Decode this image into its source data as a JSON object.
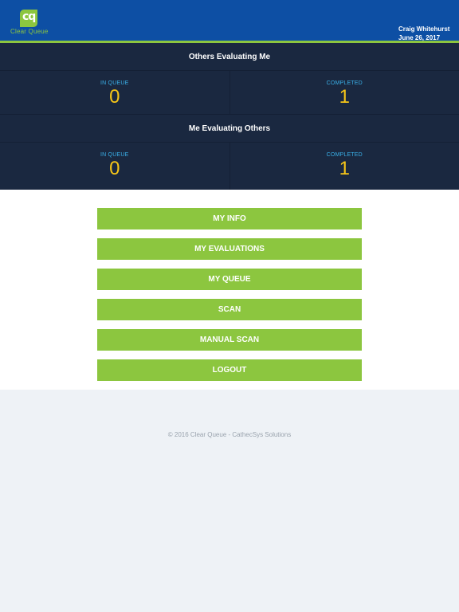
{
  "header": {
    "logo_text": "Clear Queue",
    "logo_mark": "cq",
    "user_name": "Craig Whitehurst",
    "date": "June 26, 2017"
  },
  "stats": {
    "others_evaluating_me": {
      "title": "Others Evaluating Me",
      "in_queue_label": "IN QUEUE",
      "in_queue_value": "0",
      "completed_label": "COMPLETED",
      "completed_value": "1"
    },
    "me_evaluating_others": {
      "title": "Me Evaluating Others",
      "in_queue_label": "IN QUEUE",
      "in_queue_value": "0",
      "completed_label": "COMPLETED",
      "completed_value": "1"
    }
  },
  "menu": {
    "my_info": "MY INFO",
    "my_evaluations": "MY EVALUATIONS",
    "my_queue": "MY QUEUE",
    "scan": "SCAN",
    "manual_scan": "MANUAL SCAN",
    "logout": "LOGOUT"
  },
  "footer": {
    "copyright": "© 2016 Clear Queue - CathecSys Solutions"
  },
  "colors": {
    "header_bg": "#0d4fa4",
    "accent_green": "#8cc63f",
    "panel_bg": "#1a2840",
    "label_blue": "#3ab0e8",
    "value_yellow": "#f5c518"
  }
}
